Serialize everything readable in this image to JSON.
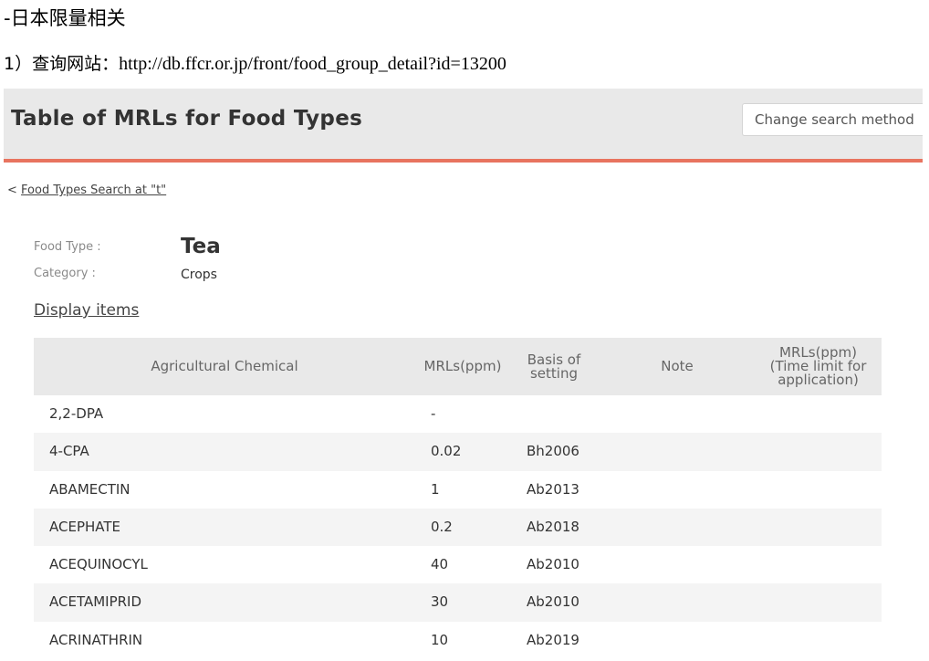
{
  "doc": {
    "heading": "-日本限量相关",
    "url_prefix": "1）查询网站：",
    "url": "http://db.ffcr.or.jp/front/food_group_detail?id=13200"
  },
  "header": {
    "title": "Table of MRLs for Food Types",
    "change_button": "Change search method"
  },
  "breadcrumb": {
    "arrow": "<",
    "link": "Food Types Search at \"t\""
  },
  "food": {
    "type_label": "Food Type :",
    "type_value": "Tea",
    "category_label": "Category :",
    "category_value": "Crops"
  },
  "display_items": "Display items",
  "table": {
    "columns": [
      "Agricultural Chemical",
      "MRLs(ppm)",
      "Basis of setting",
      "Note",
      "MRLs(ppm) (Time limit for application)"
    ],
    "rows": [
      {
        "chemical": "2,2-DPA",
        "mrl": "-",
        "basis": ""
      },
      {
        "chemical": "4-CPA",
        "mrl": "0.02",
        "basis": "Bh2006"
      },
      {
        "chemical": "ABAMECTIN",
        "mrl": "1",
        "basis": "Ab2013"
      },
      {
        "chemical": "ACEPHATE",
        "mrl": "0.2",
        "basis": "Ab2018"
      },
      {
        "chemical": "ACEQUINOCYL",
        "mrl": "40",
        "basis": "Ab2010"
      },
      {
        "chemical": "ACETAMIPRID",
        "mrl": "30",
        "basis": "Ab2010"
      },
      {
        "chemical": "ACRINATHRIN",
        "mrl": "10",
        "basis": "Ab2019"
      }
    ]
  },
  "colors": {
    "accent_bar": "#e8745f",
    "header_bg": "#e9e9e9",
    "row_alt": "#f4f4f4"
  }
}
